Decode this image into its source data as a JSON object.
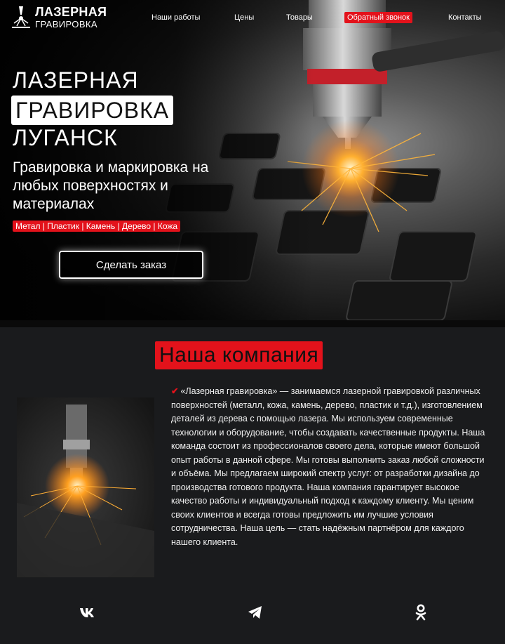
{
  "logo": {
    "title": "ЛАЗЕРНАЯ",
    "subtitle": "ГРАВИРОВКА"
  },
  "nav": {
    "items": [
      {
        "label": "Наши работы"
      },
      {
        "label": "Цены"
      },
      {
        "label": "Товары"
      },
      {
        "label": "Обратный звонок",
        "active": true
      },
      {
        "label": "Контакты"
      }
    ]
  },
  "hero": {
    "line1": "ЛАЗЕРНАЯ",
    "line2": "ГРАВИРОВКА",
    "line3": "ЛУГАНСК",
    "subtitle": "Гравировка и маркировка на любых поверхностях и материалах",
    "materials": "Метал | Пластик | Камень | Дерево | Кожа",
    "cta": "Сделать заказ"
  },
  "company": {
    "title": "Наша компания",
    "text": "«Лазерная гравировка» — занимаемся лазерной гравировкой различных поверхностей (металл, кожа, камень, дерево, пластик и т.д.), изготовлением деталей из дерева с помощью лазера. Мы используем современные технологии и оборудование, чтобы создавать качественные продукты. Наша команда состоит из профессионалов своего дела, которые имеют большой опыт работы в данной сфере. Мы готовы выполнить заказ любой сложности и объёма. Мы предлагаем широкий спектр услуг: от разработки дизайна до производства готового продукта. Наша компания гарантирует высокое качество работы и индивидуальный подход к каждому клиенту. Мы ценим своих клиентов и всегда готовы предложить им лучшие условия сотрудничества. Наша цель — стать надёжным партнёром для каждого нашего клиента."
  },
  "social": [
    {
      "icon": "vk-icon"
    },
    {
      "icon": "telegram-icon"
    },
    {
      "icon": "odnoklassniki-icon"
    }
  ],
  "colors": {
    "accent": "#e3121b",
    "background": "#0a0a0a",
    "section": "#1a1b1d"
  }
}
